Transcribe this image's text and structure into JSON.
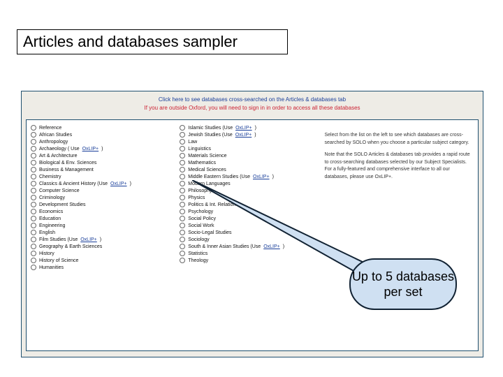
{
  "title": "Articles and databases sampler",
  "top_links": {
    "line1": "Click here to see databases cross-searched on the Articles & databases tab",
    "line2": "If you are outside Oxford, you will need to sign in in order to access all these databases"
  },
  "col1": [
    {
      "label": "Reference"
    },
    {
      "label": "African Studies"
    },
    {
      "label": "Anthropology"
    },
    {
      "label": "Archaeology ( Use ",
      "link": "OxLIP+",
      "suffix": ")"
    },
    {
      "label": "Art & Architecture"
    },
    {
      "label": "Biological & Env. Sciences"
    },
    {
      "label": "Business & Management"
    },
    {
      "label": "Chemistry"
    },
    {
      "label": "Classics & Ancient History (Use ",
      "link": "OxLIP+",
      "suffix": ")"
    },
    {
      "label": "Computer Science"
    },
    {
      "label": "Criminology"
    },
    {
      "label": "Development Studies"
    },
    {
      "label": "Economics"
    },
    {
      "label": "Education"
    },
    {
      "label": "Engineering"
    },
    {
      "label": "English"
    },
    {
      "label": "Film Studies (Use ",
      "link": "OxLIP+",
      "suffix": ")"
    },
    {
      "label": "Geography & Earth Sciences"
    },
    {
      "label": "History"
    },
    {
      "label": "History of Science"
    },
    {
      "label": "Humanities"
    }
  ],
  "col2": [
    {
      "label": "Islamic Studies (Use ",
      "link": "OxLIP+",
      "suffix": ")"
    },
    {
      "label": "Jewish Studies (Use ",
      "link": "OxLIP+",
      "suffix": ")"
    },
    {
      "label": "Law"
    },
    {
      "label": "Linguistics"
    },
    {
      "label": "Materials Science"
    },
    {
      "label": "Mathematics"
    },
    {
      "label": "Medical Sciences"
    },
    {
      "label": "Middle Eastern Studies (Use ",
      "link": "OxLIP+",
      "suffix": ")"
    },
    {
      "label": "Modern Languages"
    },
    {
      "label": "Philosophy"
    },
    {
      "label": "Physics"
    },
    {
      "label": "Politics & Int. Relations"
    },
    {
      "label": "Psychology"
    },
    {
      "label": "Social Policy"
    },
    {
      "label": "Social Work"
    },
    {
      "label": "Socio-Legal Studies"
    },
    {
      "label": "Sociology"
    },
    {
      "label": "South & Inner Asian Studies (Use ",
      "link": "OxLIP+",
      "suffix": ")"
    },
    {
      "label": "Statistics"
    },
    {
      "label": "Theology"
    }
  ],
  "info": {
    "p1": "Select from the list on the left to see which databases are cross-searched by SOLO when you choose a particular subject category.",
    "p2": "Note that the SOLO Articles & databases tab provides a rapid route to cross-searching databases selected by our Subject Specialists. For a fully-featured and comprehensive interface to all our databases, please use OxLIP+."
  },
  "callout": "Up to 5 databases per set"
}
